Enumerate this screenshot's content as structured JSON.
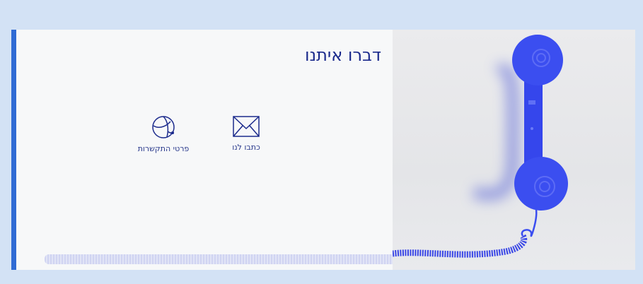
{
  "header": {
    "title": "דברו איתנו"
  },
  "options": [
    {
      "id": "write",
      "label": "כתבו לנו",
      "icon": "envelope-icon"
    },
    {
      "id": "details",
      "label": "פרטי התקשרות",
      "icon": "globe-icon"
    }
  ],
  "colors": {
    "page_bg": "#d3e2f5",
    "accent_bar": "#2f6bd4",
    "title": "#1b2a8c",
    "phone": "#3b4ef0"
  }
}
